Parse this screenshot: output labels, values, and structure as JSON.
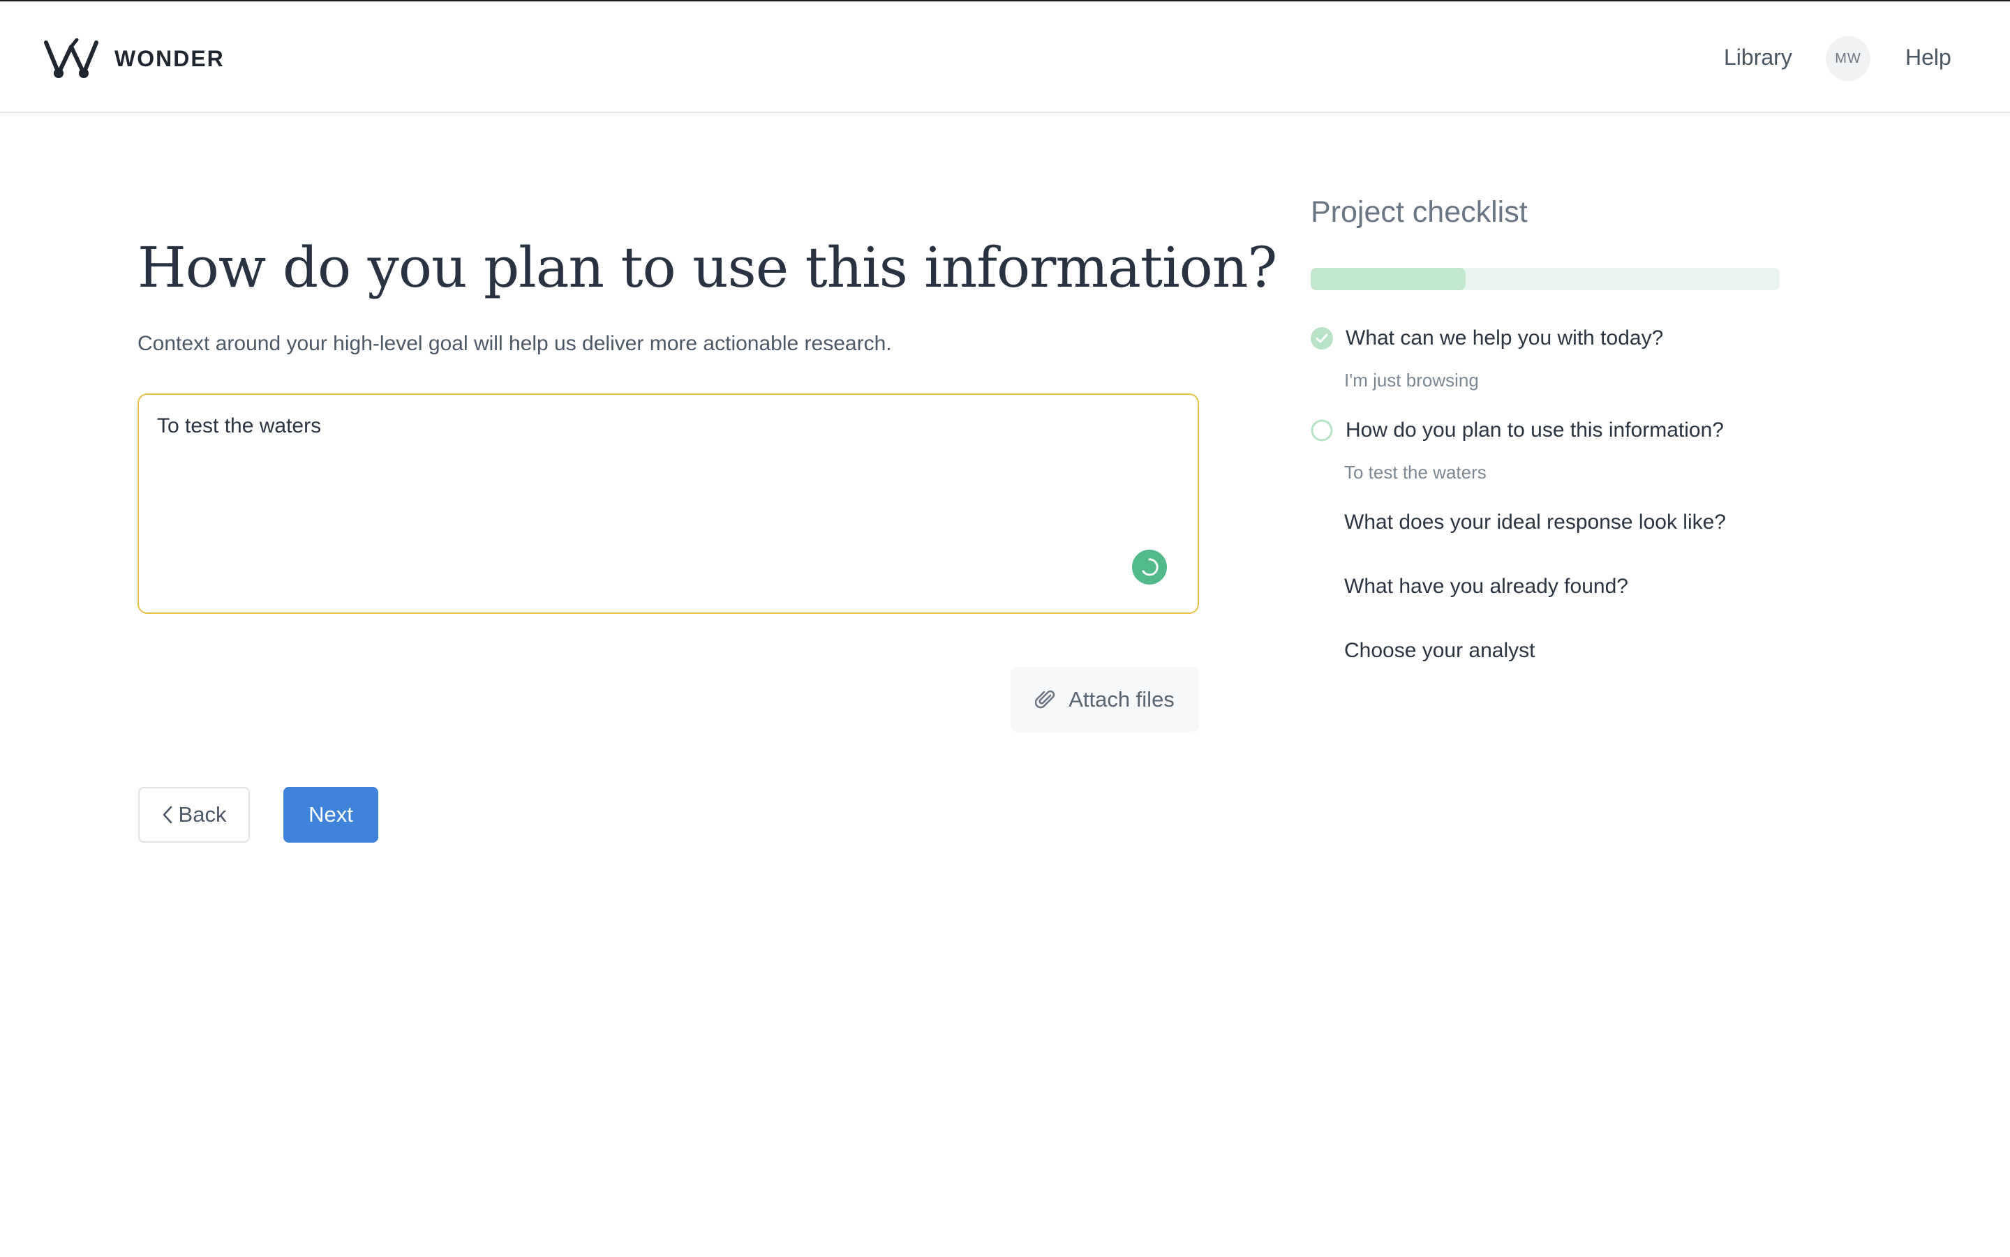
{
  "header": {
    "brand": "WONDER",
    "nav_library": "Library",
    "avatar_initials": "MW",
    "nav_help": "Help"
  },
  "main": {
    "title": "How do you plan to use this information?",
    "subtitle": "Context around your high-level goal will help us deliver more actionable research.",
    "answer_value": "To test the waters",
    "attach_label": "Attach files",
    "back_label": "Back",
    "next_label": "Next"
  },
  "checklist": {
    "title": "Project checklist",
    "progress_fraction": 0.33,
    "items": [
      {
        "label": "What can we help you with today?",
        "answer": "I'm just browsing",
        "status": "complete"
      },
      {
        "label": "How do you plan to use this information?",
        "answer": "To test the waters",
        "status": "current"
      },
      {
        "label": "What does your ideal response look like?",
        "status": "pending"
      },
      {
        "label": "What have you already found?",
        "status": "pending"
      },
      {
        "label": "Choose your analyst",
        "status": "pending"
      }
    ]
  },
  "colors": {
    "accent_blue": "#3f82d9",
    "input_border": "#e7c24a",
    "check_green": "#52b98b",
    "progress_fill": "#c3e7cf",
    "progress_track": "#eaf4ee"
  },
  "icons": {
    "logo": "wonder-logo-icon",
    "spinner": "loading-spinner-icon",
    "attach": "paperclip-icon",
    "back": "chevron-left-icon",
    "complete": "check-circle-icon",
    "current": "circle-outline-icon"
  }
}
